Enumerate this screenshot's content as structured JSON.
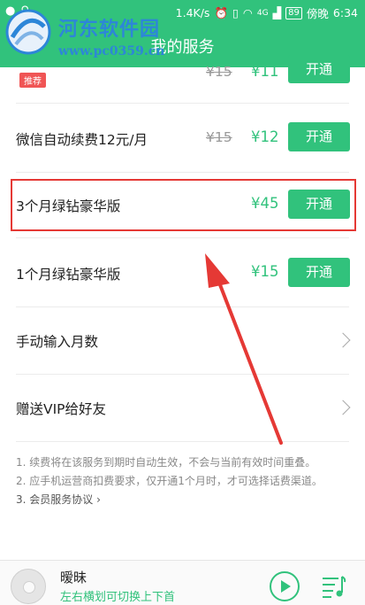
{
  "status_bar": {
    "net_speed": "1.4K/s",
    "battery": "89",
    "carrier": "傍晚",
    "time": "6:34",
    "signal": "4G"
  },
  "header": {
    "title": "我的服务",
    "watermark_text": "河东软件园",
    "watermark_url": "www.pc0359.cn"
  },
  "plans": [
    {
      "badge": "推荐",
      "old_price": "¥15",
      "price": "¥11",
      "button": "开通"
    },
    {
      "label": "微信自动续费12元/月",
      "old_price": "¥15",
      "price": "¥12",
      "button": "开通"
    },
    {
      "label": "3个月绿钻豪华版",
      "price": "¥45",
      "button": "开通"
    },
    {
      "label": "1个月绿钻豪华版",
      "price": "¥15",
      "button": "开通"
    }
  ],
  "links": [
    {
      "label": "手动输入月数"
    },
    {
      "label": "赠送VIP给好友"
    }
  ],
  "notes": {
    "note1": "1. 续费将在该服务到期时自动生效，不会与当前有效时间重叠。",
    "note2": "2. 应手机运营商扣费要求，仅开通1个月时，才可选择话费渠道。",
    "note3": "3. 会员服务协议 ›"
  },
  "player": {
    "song": "暧昧",
    "hint": "左右横划可切换上下首"
  },
  "colors": {
    "brand": "#31c27c",
    "highlight": "#e53935"
  }
}
